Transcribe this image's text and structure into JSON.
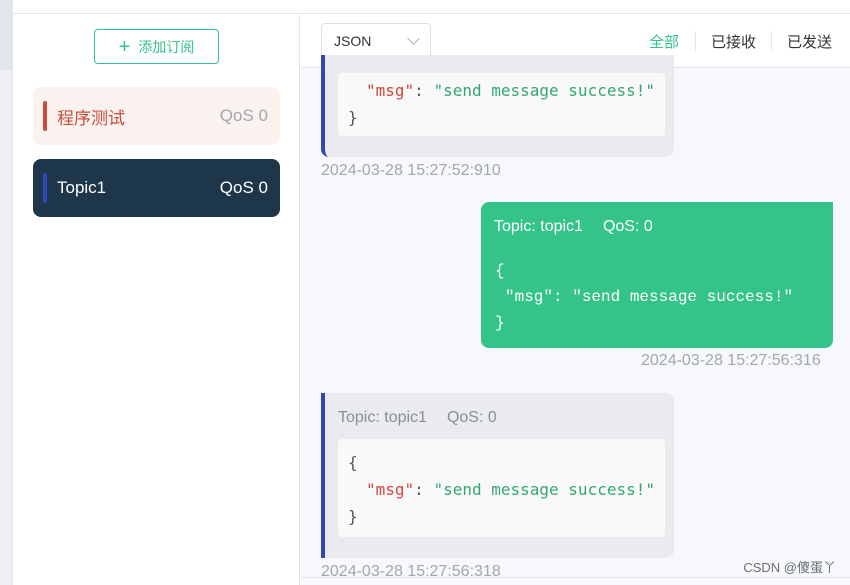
{
  "sidebar": {
    "add_button": "添加订阅",
    "subscriptions": [
      {
        "name": "程序测试",
        "qos": "QoS 0",
        "color": "#c94d3a",
        "active": false
      },
      {
        "name": "Topic1",
        "qos": "QoS 0",
        "color": "#2f47b8",
        "active": true
      }
    ]
  },
  "toolbar": {
    "format": "JSON",
    "filters": [
      "全部",
      "已接收",
      "已发送"
    ],
    "active_filter": "全部"
  },
  "messages": [
    {
      "direction": "received",
      "code_key": "\"msg\"",
      "code_sep": ": ",
      "code_value": "\"send message success!\"",
      "code_close": "}",
      "time": "2024-03-28 15:27:52:910"
    },
    {
      "direction": "sent",
      "topic": "Topic: topic1",
      "qos": "QoS: 0",
      "code_open": "{",
      "code_line": "\"msg\": \"send message success!\"",
      "code_close": "}",
      "time": "2024-03-28 15:27:56:316"
    },
    {
      "direction": "received",
      "topic": "Topic: topic1",
      "qos": "QoS: 0",
      "code_open": "{",
      "code_key": "\"msg\"",
      "code_sep": ": ",
      "code_value": "\"send message success!\"",
      "code_close": "}",
      "time": "2024-03-28 15:27:56:318"
    }
  ],
  "watermark": "CSDN @傻蛋丫",
  "colors": {
    "accent": "#34c388",
    "topic1": "#2f47b8",
    "test": "#c94d3a",
    "dark_item": "#1e3649"
  }
}
